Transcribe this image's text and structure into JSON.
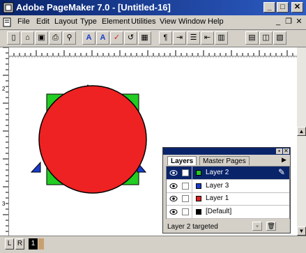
{
  "window": {
    "title": "Adobe PageMaker 7.0 - [Untitled-16]",
    "minimize": "_",
    "maximize": "□",
    "close": "✕"
  },
  "menu": {
    "items": [
      "File",
      "Edit",
      "Layout",
      "Type",
      "Element",
      "Utilities",
      "View",
      "Window",
      "Help"
    ],
    "mdi_min": "_",
    "mdi_restore": "❐",
    "mdi_close": "✕"
  },
  "toolbar": {
    "buttons": [
      {
        "icon": "new-document-icon",
        "glyph": "▯"
      },
      {
        "icon": "open-folder-icon",
        "glyph": "⌂"
      },
      {
        "icon": "save-icon",
        "glyph": "▣"
      },
      {
        "icon": "print-icon",
        "glyph": "⎙"
      },
      {
        "icon": "find-icon",
        "glyph": "⚲"
      },
      {
        "icon": "character-style-icon",
        "glyph": "A"
      },
      {
        "icon": "font-icon",
        "glyph": "A"
      },
      {
        "icon": "spell-check-icon",
        "glyph": "✓"
      },
      {
        "icon": "place-icon",
        "glyph": "↺"
      },
      {
        "icon": "image-icon",
        "glyph": "▦"
      },
      {
        "icon": "paragraph-icon",
        "glyph": "¶"
      },
      {
        "icon": "indent-icon",
        "glyph": "⇥"
      },
      {
        "icon": "bullets-icon",
        "glyph": "☰"
      },
      {
        "icon": "align-icon",
        "glyph": "⇤"
      },
      {
        "icon": "columns-icon",
        "glyph": "▥"
      },
      {
        "icon": "frame-icon",
        "glyph": "▤"
      },
      {
        "icon": "layers-icon",
        "glyph": "◫"
      },
      {
        "icon": "styles-icon",
        "glyph": "▧"
      }
    ]
  },
  "rulers": {
    "vertical_labels": [
      "1",
      "2",
      "3"
    ]
  },
  "status": {
    "page_left": "L",
    "page_right": "R",
    "page_current": "1"
  },
  "layers_palette": {
    "tabs": [
      "Layers",
      "Master Pages"
    ],
    "layers": [
      {
        "name": "Layer 2",
        "color": "#22cc22",
        "selected": true
      },
      {
        "name": "Layer 3",
        "color": "#1a3ccc",
        "selected": false
      },
      {
        "name": "Layer 1",
        "color": "#dd2222",
        "selected": false
      },
      {
        "name": "[Default]",
        "color": "#000000",
        "selected": false
      }
    ],
    "status_text": "Layer 2 targeted"
  },
  "colors": {
    "square": "#22cc22",
    "triangles": "#1a3ccc",
    "circle": "#ee2222",
    "titlebar": "#0a246a",
    "selection": "#0a246a"
  }
}
